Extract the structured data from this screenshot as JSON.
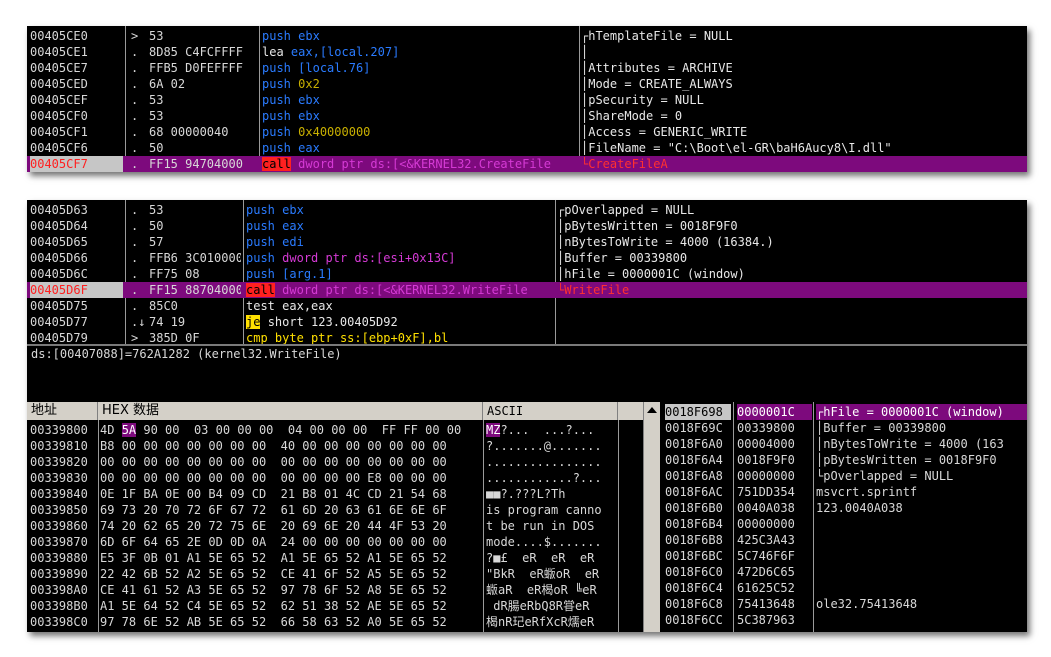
{
  "panel1": {
    "rows": [
      {
        "addr": "00405CE0",
        "mark": ">",
        "bytes": "53",
        "mn": "push",
        "mnc": "kw-push",
        "op": "ebx",
        "opc": "op-reg",
        "cmt": "┌hTemplateFile = NULL",
        "hl": false
      },
      {
        "addr": "00405CE1",
        "mark": ".",
        "bytes": "8D85 C4FCFFFF",
        "mn": "lea",
        "mnc": "kw-lea",
        "op": "eax,[local.207]",
        "opc": "op-ref",
        "cmt": "│",
        "hl": false
      },
      {
        "addr": "00405CE7",
        "mark": ".",
        "bytes": "FFB5 D0FEFFFF",
        "mn": "push",
        "mnc": "kw-push",
        "op": "[local.76]",
        "opc": "op-ref",
        "cmt": "│Attributes = ARCHIVE",
        "hl": false
      },
      {
        "addr": "00405CED",
        "mark": ".",
        "bytes": "6A 02",
        "mn": "push",
        "mnc": "kw-push",
        "op": "0x2",
        "opc": "op-num",
        "cmt": "│Mode = CREATE_ALWAYS",
        "hl": false
      },
      {
        "addr": "00405CEF",
        "mark": ".",
        "bytes": "53",
        "mn": "push",
        "mnc": "kw-push",
        "op": "ebx",
        "opc": "op-reg",
        "cmt": "│pSecurity = NULL",
        "hl": false
      },
      {
        "addr": "00405CF0",
        "mark": ".",
        "bytes": "53",
        "mn": "push",
        "mnc": "kw-push",
        "op": "ebx",
        "opc": "op-reg",
        "cmt": "│ShareMode = 0",
        "hl": false
      },
      {
        "addr": "00405CF1",
        "mark": ".",
        "bytes": "68 00000040",
        "mn": "push",
        "mnc": "kw-push",
        "op": "0x40000000",
        "opc": "op-num",
        "cmt": "│Access = GENERIC_WRITE",
        "hl": false
      },
      {
        "addr": "00405CF6",
        "mark": ".",
        "bytes": "50",
        "mn": "push",
        "mnc": "kw-push",
        "op": "eax",
        "opc": "op-reg",
        "cmt": "│FileName = \"C:\\Boot\\el-GR\\baH6Aucy8\\I.dll\"",
        "hl": false
      },
      {
        "addr": "00405CF7",
        "mark": ".",
        "bytes": "FF15 94704000",
        "mn": "call",
        "mnc": "kw-call",
        "op": "dword ptr ds:[<&KERNEL32.CreateFile",
        "opc": "op-mem",
        "cmt": "└CreateFileA",
        "hl": true
      }
    ]
  },
  "panel2": {
    "rows": [
      {
        "addr": "00405D63",
        "mark": ".",
        "bytes": "53",
        "mn": "push",
        "mnc": "kw-push",
        "op": "ebx",
        "opc": "op-reg",
        "cmt": "┌pOverlapped = NULL",
        "hl": false
      },
      {
        "addr": "00405D64",
        "mark": ".",
        "bytes": "50",
        "mn": "push",
        "mnc": "kw-push",
        "op": "eax",
        "opc": "op-reg",
        "cmt": "│pBytesWritten = 0018F9F0",
        "hl": false
      },
      {
        "addr": "00405D65",
        "mark": ".",
        "bytes": "57",
        "mn": "push",
        "mnc": "kw-push",
        "op": "edi",
        "opc": "op-reg",
        "cmt": "│nBytesToWrite = 4000 (16384.)",
        "hl": false
      },
      {
        "addr": "00405D66",
        "mark": ".",
        "bytes": "FFB6 3C010000",
        "mn": "push",
        "mnc": "kw-push",
        "op": "dword ptr ds:[esi+0x13C]",
        "opc": "op-mem",
        "cmt": "│Buffer = 00339800",
        "hl": false
      },
      {
        "addr": "00405D6C",
        "mark": ".",
        "bytes": "FF75 08",
        "mn": "push",
        "mnc": "kw-push",
        "op": "[arg.1]",
        "opc": "op-ref",
        "cmt": "│hFile = 0000001C (window)",
        "hl": false
      },
      {
        "addr": "00405D6F",
        "mark": ".",
        "bytes": "FF15 88704000",
        "mn": "call",
        "mnc": "kw-call",
        "op": "dword ptr ds:[<&KERNEL32.WriteFile",
        "opc": "op-mem",
        "cmt": "└WriteFile",
        "hl": true
      },
      {
        "addr": "00405D75",
        "mark": ".",
        "bytes": "85C0",
        "mn": "test",
        "mnc": "kw-test",
        "op": "eax,eax",
        "opc": "op-plain",
        "cmt": "",
        "hl": false
      },
      {
        "addr": "00405D77",
        "mark": ".↓",
        "bytes": "74 19",
        "mn": "je",
        "mnc": "kw-je",
        "op": "short 123.00405D92",
        "opc": "op-plain",
        "cmt": "",
        "hl": false
      },
      {
        "addr": "00405D79",
        "mark": ">",
        "bytes": "385D 0F",
        "mn": "cmp",
        "mnc": "kw-cmp",
        "op": "byte ptr ss:[ebp+0xF],bl",
        "opc": "op-cmp",
        "cmt": "",
        "hl": false
      }
    ],
    "info": "ds:[00407088]=762A1282 (kernel32.WriteFile)"
  },
  "dump": {
    "headers": {
      "addr": "地址",
      "hex": "HEX 数据",
      "ascii": "ASCII"
    },
    "rows": [
      {
        "addr": "00339800",
        "pre": "4D ",
        "sel": "5A",
        "post": " 90 00  03 00 00 00  04 00 00 00  FF FF 00 00",
        "ascii_sel": "MZ",
        "ascii": "?...  ...?..."
      },
      {
        "addr": "00339810",
        "pre": "B8 00 00 00 00 00 00 00  40 00 00 00 00 00 00 00",
        "sel": "",
        "post": "",
        "ascii_sel": "",
        "ascii": "?.......@......."
      },
      {
        "addr": "00339820",
        "pre": "00 00 00 00 00 00 00 00  00 00 00 00 00 00 00 00",
        "sel": "",
        "post": "",
        "ascii_sel": "",
        "ascii": "................"
      },
      {
        "addr": "00339830",
        "pre": "00 00 00 00 00 00 00 00  00 00 00 00 E8 00 00 00",
        "sel": "",
        "post": "",
        "ascii_sel": "",
        "ascii": "............?..."
      },
      {
        "addr": "00339840",
        "pre": "0E 1F BA 0E 00 B4 09 CD  21 B8 01 4C CD 21 54 68",
        "sel": "",
        "post": "",
        "ascii_sel": "",
        "ascii": "■■?.???L?Th"
      },
      {
        "addr": "00339850",
        "pre": "69 73 20 70 72 6F 67 72  61 6D 20 63 61 6E 6E 6F",
        "sel": "",
        "post": "",
        "ascii_sel": "",
        "ascii": "is program canno"
      },
      {
        "addr": "00339860",
        "pre": "74 20 62 65 20 72 75 6E  20 69 6E 20 44 4F 53 20",
        "sel": "",
        "post": "",
        "ascii_sel": "",
        "ascii": "t be run in DOS "
      },
      {
        "addr": "00339870",
        "pre": "6D 6F 64 65 2E 0D 0D 0A  24 00 00 00 00 00 00 00",
        "sel": "",
        "post": "",
        "ascii_sel": "",
        "ascii": "mode....$......."
      },
      {
        "addr": "00339880",
        "pre": "E5 3F 0B 01 A1 5E 65 52  A1 5E 65 52 A1 5E 65 52",
        "sel": "",
        "post": "",
        "ascii_sel": "",
        "ascii": "?■£  eR  eR  eR"
      },
      {
        "addr": "00339890",
        "pre": "22 42 6B 52 A2 5E 65 52  CE 41 6F 52 A5 5E 65 52",
        "sel": "",
        "post": "",
        "ascii_sel": "",
        "ascii": "\"BkR  eR蝂oR  eR"
      },
      {
        "addr": "003398A0",
        "pre": "CE 41 61 52 A3 5E 65 52  97 78 6F 52 A8 5E 65 52",
        "sel": "",
        "post": "",
        "ascii_sel": "",
        "ascii": "蝂aR  eR楬oR ╚eR"
      },
      {
        "addr": "003398B0",
        "pre": "A1 5E 64 52 C4 5E 65 52  62 51 38 52 AE 5E 65 52",
        "sel": "",
        "post": "",
        "ascii_sel": "",
        "ascii": " dR腸eRbQ8R甞eR"
      },
      {
        "addr": "003398C0",
        "pre": "97 78 6E 52 AB 5E 65 52  66 58 63 52 A0 5E 65 52",
        "sel": "",
        "post": "",
        "ascii_sel": "",
        "ascii": "楬nR玘eRfXcR燸eR"
      }
    ]
  },
  "stack": {
    "rows": [
      {
        "addr": "0018F698",
        "val": "0000001C",
        "cmt": "┌hFile = 0000001C (window)",
        "hl": true
      },
      {
        "addr": "0018F69C",
        "val": "00339800",
        "cmt": "│Buffer = 00339800",
        "hl": false
      },
      {
        "addr": "0018F6A0",
        "val": "00004000",
        "cmt": "│nBytesToWrite = 4000 (163",
        "hl": false
      },
      {
        "addr": "0018F6A4",
        "val": "0018F9F0",
        "cmt": "│pBytesWritten = 0018F9F0",
        "hl": false
      },
      {
        "addr": "0018F6A8",
        "val": "00000000",
        "cmt": "└pOverlapped = NULL",
        "hl": false
      },
      {
        "addr": "0018F6AC",
        "val": "751DD354",
        "cmt": "msvcrt.sprintf",
        "hl": false
      },
      {
        "addr": "0018F6B0",
        "val": "0040A038",
        "cmt": "123.0040A038",
        "hl": false
      },
      {
        "addr": "0018F6B4",
        "val": "00000000",
        "cmt": "",
        "hl": false
      },
      {
        "addr": "0018F6B8",
        "val": "425C3A43",
        "cmt": "",
        "hl": false
      },
      {
        "addr": "0018F6BC",
        "val": "5C746F6F",
        "cmt": "",
        "hl": false
      },
      {
        "addr": "0018F6C0",
        "val": "472D6C65",
        "cmt": "",
        "hl": false
      },
      {
        "addr": "0018F6C4",
        "val": "61625C52",
        "cmt": "",
        "hl": false
      },
      {
        "addr": "0018F6C8",
        "val": "75413648",
        "cmt": "ole32.75413648",
        "hl": false
      },
      {
        "addr": "0018F6CC",
        "val": "5C387963",
        "cmt": "",
        "hl": false
      }
    ]
  }
}
